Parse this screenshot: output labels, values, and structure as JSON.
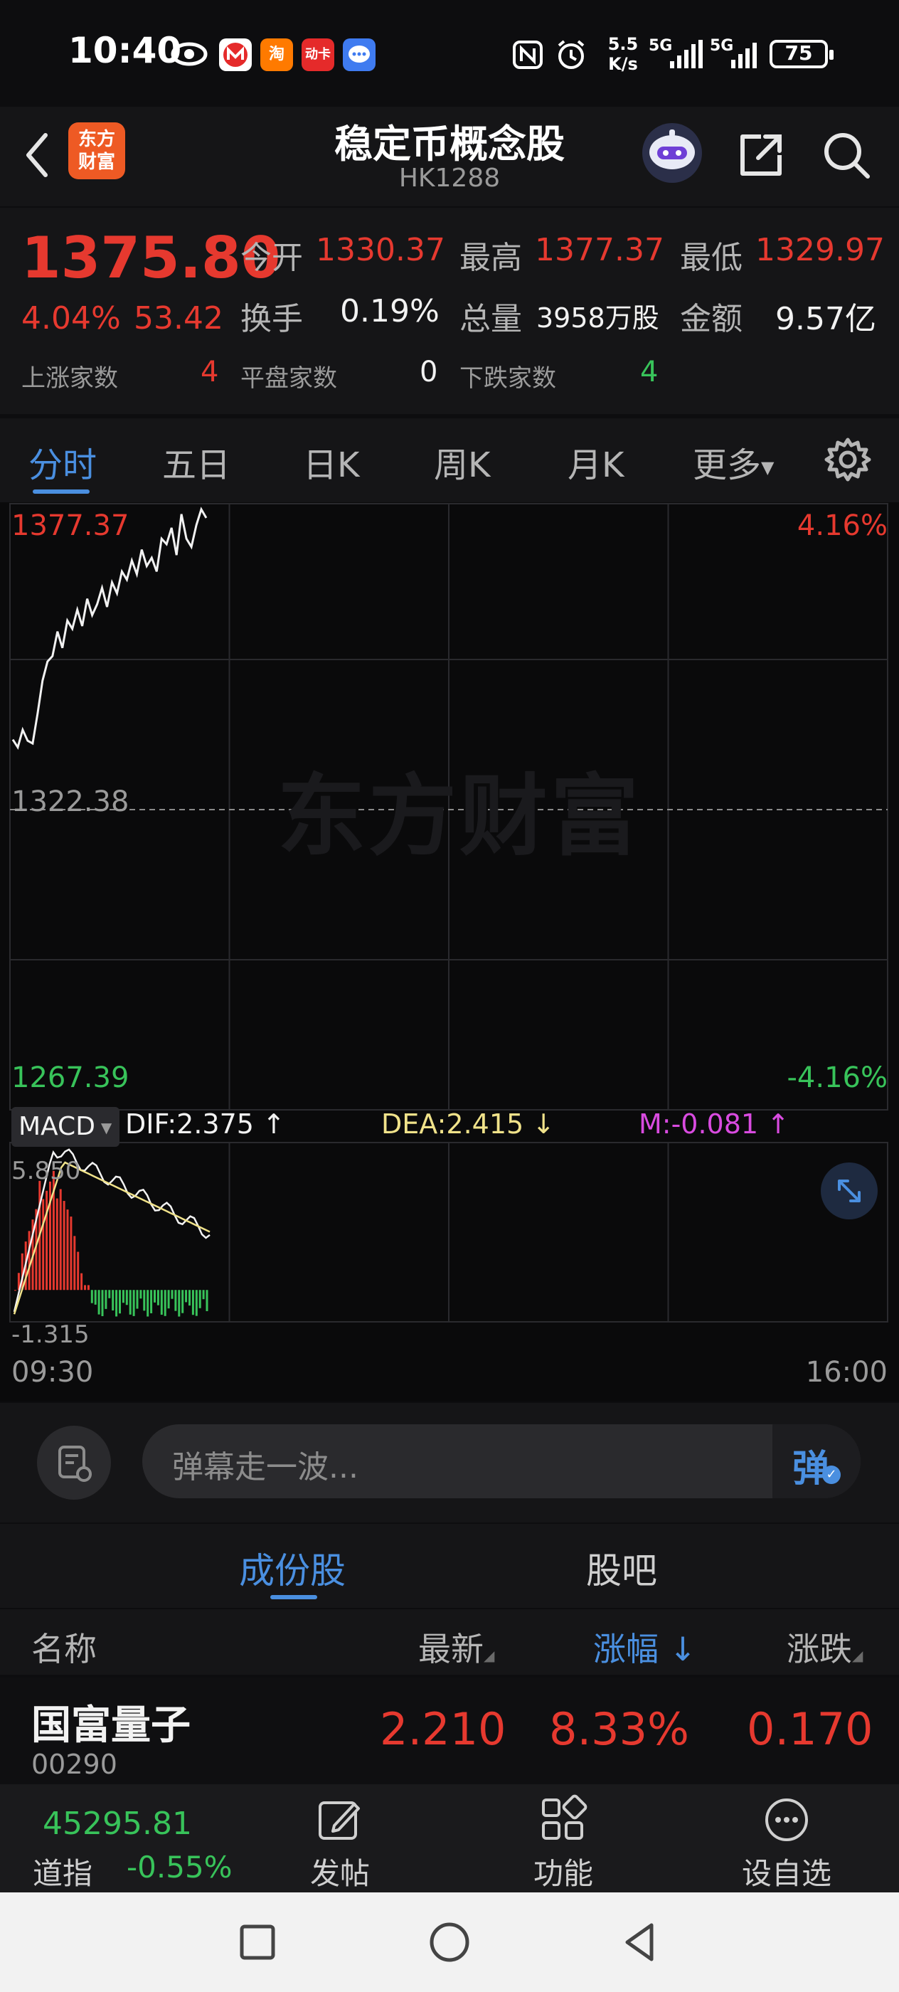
{
  "status_bar": {
    "time": "10:40",
    "net_speed_top": "5.5",
    "net_speed_bottom": "K/s",
    "sig1": "5G",
    "sig2": "5G",
    "battery": "75",
    "apps": [
      "淘",
      "动卡"
    ]
  },
  "header": {
    "title": "稳定币概念股",
    "code": "HK1288",
    "logo_line1": "东方",
    "logo_line2": "财富"
  },
  "quote": {
    "price": "1375.80",
    "change_pct": "4.04%",
    "change_amt": "53.42",
    "open_label": "今开",
    "open": "1330.37",
    "high_label": "最高",
    "high": "1377.37",
    "low_label": "最低",
    "low": "1329.97",
    "turnover_label": "换手",
    "turnover": "0.19%",
    "volume_label": "总量",
    "volume": "3958万股",
    "amount_label": "金额",
    "amount": "9.57亿",
    "up_label": "上涨家数",
    "up": "4",
    "flat_label": "平盘家数",
    "flat": "0",
    "down_label": "下跌家数",
    "down": "4"
  },
  "chart_tabs": [
    "分时",
    "五日",
    "日K",
    "周K",
    "月K",
    "更多"
  ],
  "chart": {
    "y_top": "1377.37",
    "y_mid": "1322.38",
    "y_bottom": "1267.39",
    "pct_top": "4.16%",
    "pct_bottom": "-4.16%",
    "watermark": "东方财富",
    "time_start": "09:30",
    "time_end": "16:00",
    "macd_select": "MACD",
    "dif": "DIF:2.375",
    "dea": "DEA:2.415",
    "m": "M:-0.081",
    "macd_max": "5.850",
    "macd_min": "-1.315"
  },
  "chart_data": {
    "type": "line",
    "title": "",
    "xlabel": "",
    "ylabel": "",
    "ylim": [
      1267.39,
      1377.37
    ],
    "y_reference": 1322.38,
    "x_range": [
      "09:30",
      "16:00"
    ],
    "series": [
      {
        "values": [
          1335.2,
          1333.8,
          1337.0,
          1335.0,
          1334.5,
          1340.0,
          1346.0,
          1349.5,
          1350.5,
          1355.0,
          1352.0,
          1357.0,
          1355.5,
          1359.0,
          1356.0,
          1361.0,
          1358.0,
          1360.0,
          1363.0,
          1359.5,
          1364.0,
          1362.0,
          1366.0,
          1364.5,
          1368.0,
          1365.5,
          1370.0,
          1367.0,
          1368.5,
          1366.0,
          1372.0,
          1371.0,
          1374.0,
          1369.0,
          1376.5,
          1372.0,
          1370.5,
          1374.5,
          1377.37,
          1375.8
        ]
      }
    ],
    "macd": {
      "ylim": [
        -1.315,
        5.85
      ],
      "dif_last": 2.375,
      "dea_last": 2.415,
      "m_last": -0.081
    }
  },
  "danmaku": {
    "placeholder": "弹幕走一波...",
    "button": "弹"
  },
  "component_tabs": [
    "成份股",
    "股吧"
  ],
  "table": {
    "headers": [
      "名称",
      "最新",
      "涨幅",
      "涨跌"
    ],
    "rows": [
      {
        "name": "国富量子",
        "code": "00290",
        "last": "2.210",
        "pct": "8.33%",
        "chg": "0.170"
      }
    ]
  },
  "toolbar": {
    "index_value": "45295.81",
    "index_name": "道指",
    "index_pct": "-0.55%",
    "items": [
      "发帖",
      "功能",
      "设自选"
    ]
  },
  "colors": {
    "up": "#e6392f",
    "down": "#38c35a",
    "accent": "#4a8fe0",
    "background": "#0d0d0f"
  }
}
